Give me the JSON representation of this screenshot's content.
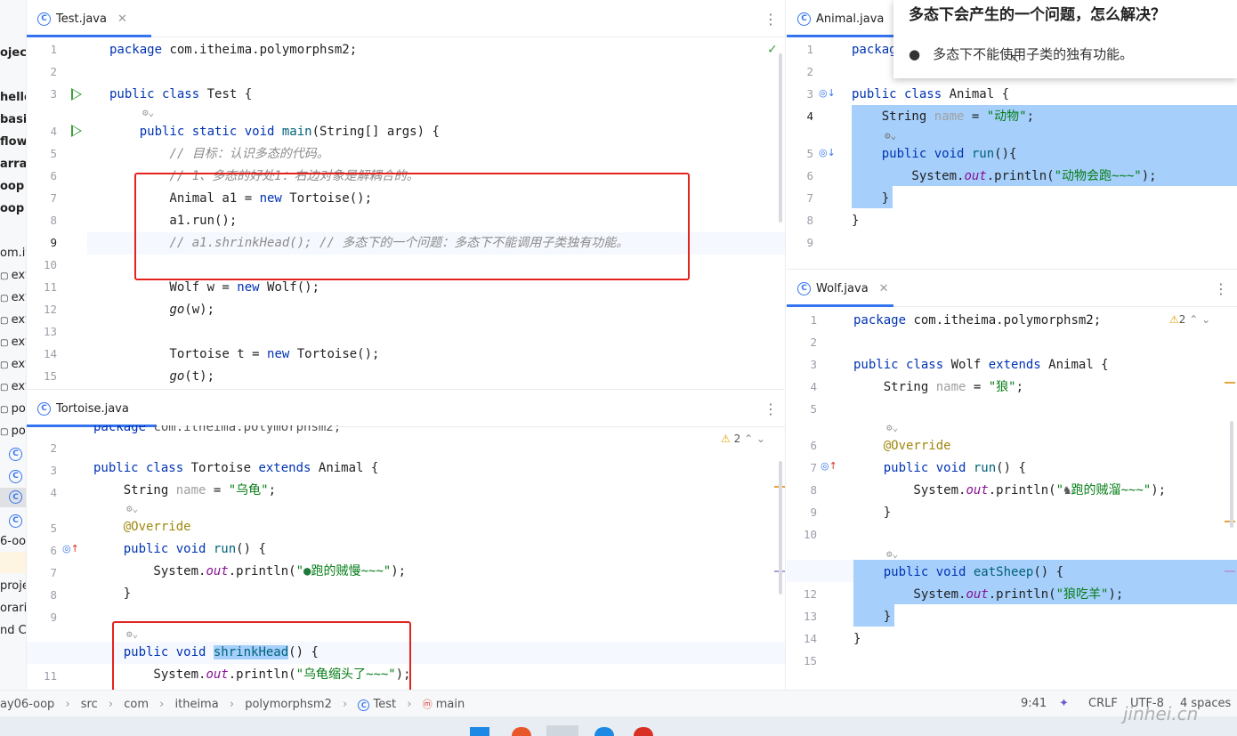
{
  "project_panel": {
    "items": [
      "oject",
      "hello",
      "basic",
      "flow-",
      "array",
      "oop",
      "oop",
      "om.it",
      "ext",
      "ext",
      "ext",
      "ext",
      "ext",
      "ext",
      "pol",
      "pol",
      "",
      "",
      "",
      "",
      "6-oo",
      "",
      "proje",
      "orarie",
      "nd C"
    ]
  },
  "test_pane": {
    "tab_label": "Test.java",
    "line_numbers": [
      "1",
      "2",
      "3",
      "4",
      "5",
      "6",
      "7",
      "8",
      "9",
      "10",
      "11",
      "12",
      "13",
      "14",
      "15"
    ]
  },
  "tortoise_pane": {
    "tab_label": "Tortoise.java",
    "warning_count": "2",
    "line_numbers": [
      "2",
      "3",
      "4",
      "",
      "5",
      "6",
      "7",
      "8",
      "9",
      "",
      "10",
      "11"
    ]
  },
  "animal_pane": {
    "tab_label": "Animal.java",
    "line_numbers": [
      "1",
      "2",
      "3",
      "4",
      "",
      "5",
      "6",
      "7",
      "8",
      "9"
    ]
  },
  "wolf_pane": {
    "tab_label": "Wolf.java",
    "warning_count": "2",
    "line_numbers": [
      "1",
      "2",
      "3",
      "4",
      "5",
      "",
      "6",
      "7",
      "8",
      "9",
      "10",
      "",
      "11",
      "12",
      "13",
      "14",
      "15"
    ]
  },
  "tooltip": {
    "title": "多态下会产生的一个问题，怎么解决？",
    "bullet": "多态下不能使用子类的独有功能。"
  },
  "breadcrumb": {
    "items": [
      "ay06-oop",
      "src",
      "com",
      "itheima",
      "polymorphsm2",
      "Test",
      "main"
    ]
  },
  "status": {
    "position": "9:41",
    "line_ending": "CRLF",
    "encoding": "UTF-8",
    "indent": "4 spaces"
  },
  "watermark": "jinhei.cn",
  "colors": {
    "keyword": "#0033b3",
    "string": "#067d17",
    "comment": "#8c8c8c",
    "selection": "#a6cffc",
    "red_box": "#e3231d",
    "accent": "#3574f0"
  }
}
